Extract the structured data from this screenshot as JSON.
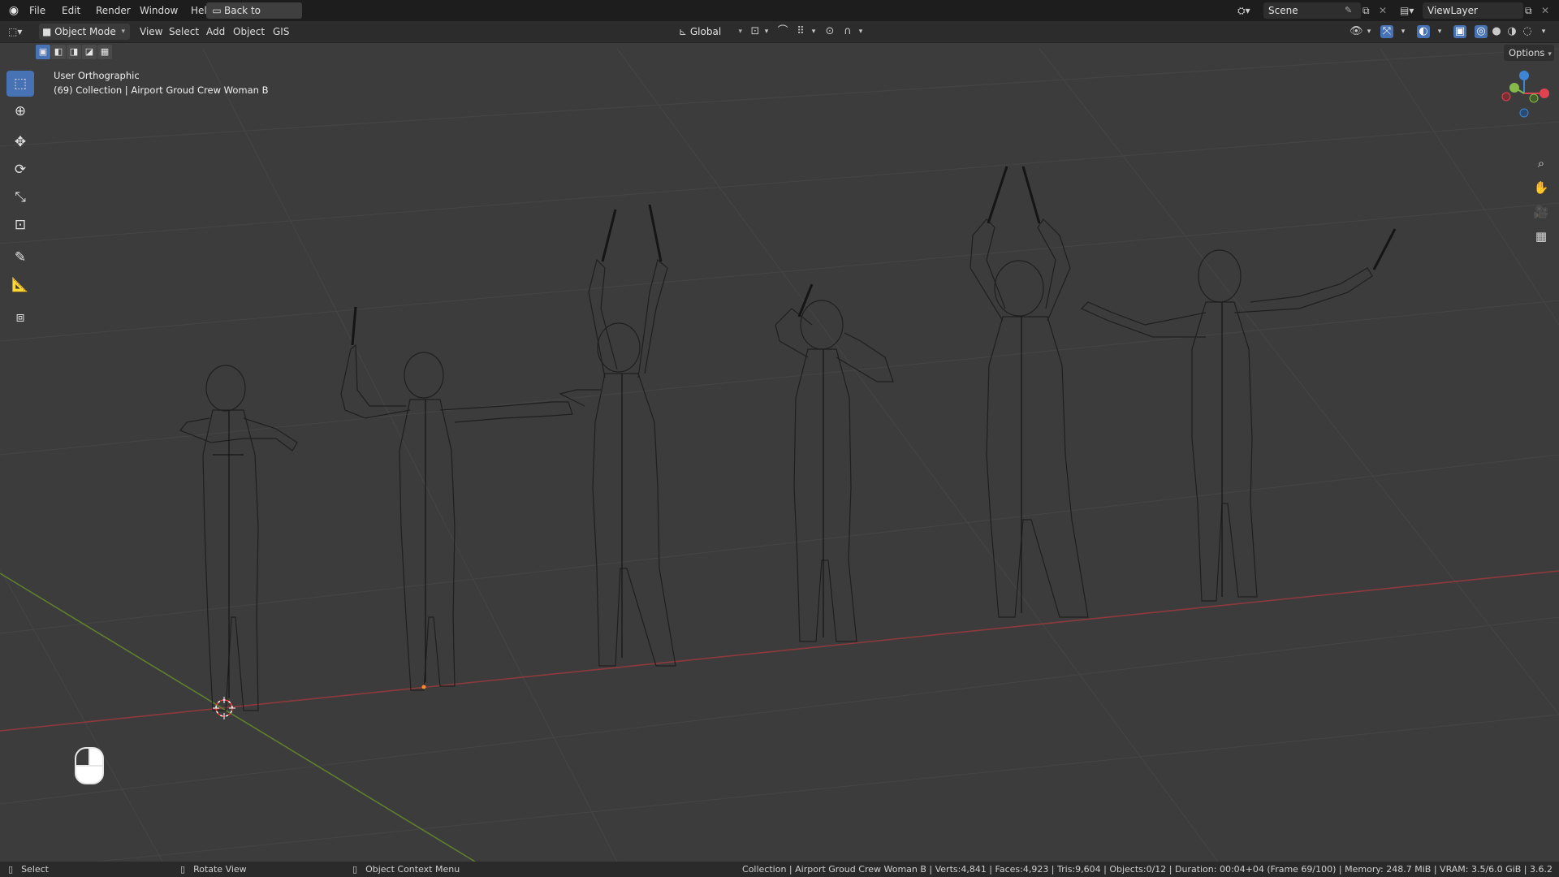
{
  "menubar": {
    "items": [
      "File",
      "Edit",
      "Render",
      "Window",
      "Help"
    ],
    "back_button": "Back to Previous",
    "scene_label": "Scene",
    "viewlayer_label": "ViewLayer"
  },
  "header": {
    "mode": "Object Mode",
    "menus": [
      "View",
      "Select",
      "Add",
      "Object",
      "GIS"
    ],
    "orientation": "Global",
    "options_label": "Options"
  },
  "viewport": {
    "view_name": "User Orthographic",
    "collection_info": "(69) Collection | Airport Groud Crew Woman B"
  },
  "gizmo": {
    "axis_x": "X",
    "axis_y": "Y",
    "axis_z": "Z",
    "colors": {
      "x": "#e0434f",
      "y": "#87b94a",
      "z": "#3e85d6"
    }
  },
  "statusbar": {
    "select": "Select",
    "rotate_view": "Rotate View",
    "context_menu": "Object Context Menu",
    "stats": "Collection | Airport Groud Crew Woman B | Verts:4,841 | Faces:4,923 | Tris:9,604 | Objects:0/12 | Duration: 00:04+04 (Frame 69/100) | Memory: 248.7 MiB | VRAM: 3.5/6.0 GiB | 3.6.2"
  },
  "icons": {
    "blender": "blender-logo-icon",
    "tools": [
      "select-box-icon",
      "cursor-icon",
      "move-icon",
      "rotate-icon",
      "scale-icon",
      "transform-icon",
      "annotate-icon",
      "measure-icon",
      "add-cube-icon"
    ]
  }
}
